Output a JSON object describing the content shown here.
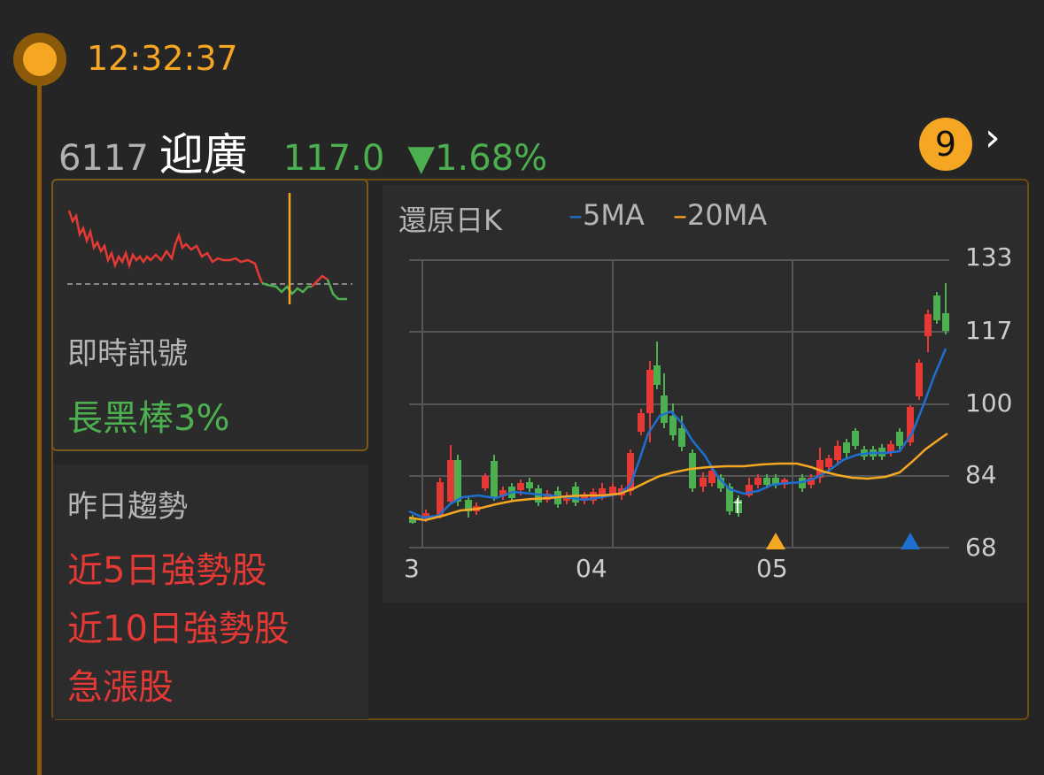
{
  "time": "12:32:37",
  "stock": {
    "code": "6117",
    "name": "迎廣",
    "price": "117.0",
    "change": "▼1.68%"
  },
  "badge_count": "9",
  "signal": {
    "label": "即時訊號",
    "value": "長黑棒3%"
  },
  "trend": {
    "label": "昨日趨勢",
    "items": [
      "近5日強勢股",
      "近10日強勢股",
      "急漲股"
    ]
  },
  "chart": {
    "title": "還原日K",
    "legend": [
      {
        "name": "5MA",
        "color": "#1e6fd0"
      },
      {
        "name": "20MA",
        "color": "#f5a623"
      }
    ],
    "y_ticks": [
      "133",
      "117",
      "100",
      "84",
      "68"
    ],
    "x_ticks": [
      "3",
      "04",
      "05"
    ]
  },
  "colors": {
    "up": "#e53935",
    "down": "#4caf50",
    "accent": "#f5a623",
    "ma5": "#1e6fd0"
  }
}
